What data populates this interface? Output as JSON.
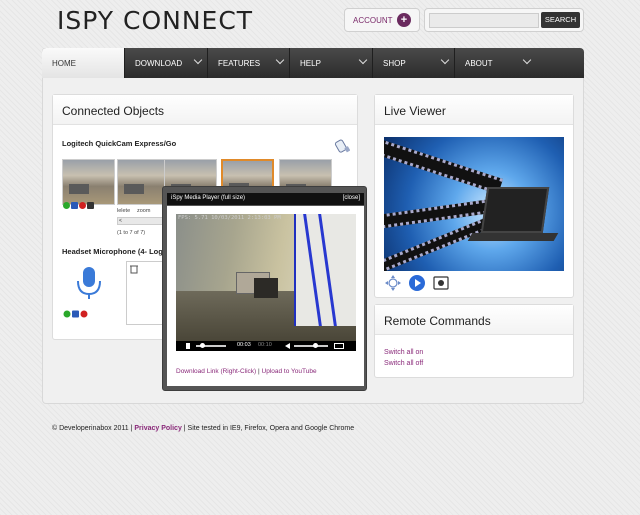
{
  "header": {
    "logo": "ISPY CONNECT",
    "account_label": "ACCOUNT",
    "search_placeholder": "",
    "search_button": "SEARCH"
  },
  "nav": {
    "items": [
      "HOME",
      "DOWNLOAD",
      "FEATURES",
      "HELP",
      "SHOP",
      "ABOUT"
    ]
  },
  "connected_objects": {
    "title": "Connected Objects",
    "camera_name": "Logitech QuickCam Express/Go",
    "row_text_1": "lelete",
    "row_text_2": "zoom",
    "scroll_arrow": "<",
    "pager": "(1 to 7 of 7)",
    "mic_name": "Headset Microphone (4- Logit"
  },
  "live_viewer": {
    "title": "Live Viewer"
  },
  "remote_commands": {
    "title": "Remote Commands",
    "links": [
      "Switch all on",
      "Switch all off"
    ]
  },
  "player": {
    "title": "iSpy Media Player (full size)",
    "close": "[close]",
    "overlay": "FPS: 5.71 10/03/2011 2:13:03 PM",
    "time_current": "00:03",
    "time_total": "00:10",
    "download_link": "Download Link (Right-Click)",
    "separator": "|",
    "youtube_link": "Upload to YouTube"
  },
  "footer": {
    "copyright": "© Developerinabox 2011 |",
    "privacy": "Privacy Policy",
    "tested": "| Site tested in IE9, Firefox, Opera and Google Chrome"
  },
  "colors": {
    "accent": "#8a2a7a",
    "nav_bg": "#2b2b2b",
    "selected_thumb": "#e08a2a"
  }
}
